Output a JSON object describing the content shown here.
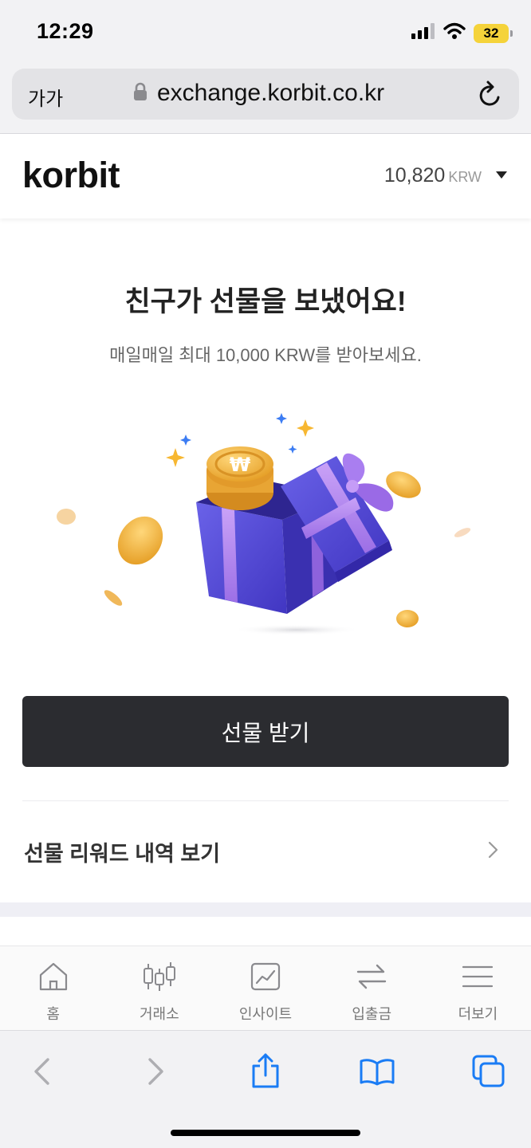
{
  "status_bar": {
    "time": "12:29",
    "battery": "32",
    "icons": [
      "signal-icon",
      "wifi-icon",
      "battery-icon"
    ]
  },
  "browser": {
    "text_size_label": "가가",
    "url": "exchange.korbit.co.kr",
    "icons": [
      "lock-icon",
      "reload-icon"
    ],
    "toolbar": [
      "back-icon",
      "forward-icon",
      "share-icon",
      "bookmarks-icon",
      "tabs-icon"
    ],
    "accent_color": "#1a7cf5"
  },
  "header": {
    "logo": "korbit",
    "balance_value": "10,820",
    "balance_unit": "KRW"
  },
  "main": {
    "headline": "친구가 선물을 보냈어요!",
    "subline": "매일매일 최대 10,000 KRW를 받아보세요.",
    "illustration": "gift-box-with-coins",
    "coin_symbol": "₩",
    "cta_label": "선물 받기",
    "history_label": "선물 리워드 내역 보기"
  },
  "tab_bar": {
    "items": [
      {
        "label": "홈",
        "icon": "home-icon"
      },
      {
        "label": "거래소",
        "icon": "candlestick-icon"
      },
      {
        "label": "인사이트",
        "icon": "chart-icon"
      },
      {
        "label": "입출금",
        "icon": "transfer-icon"
      },
      {
        "label": "더보기",
        "icon": "menu-icon"
      }
    ]
  },
  "colors": {
    "cta_background": "#2b2c30",
    "gift_box": "#5a4fd6",
    "ribbon": "#b38af0",
    "coin": "#f3b63f"
  }
}
